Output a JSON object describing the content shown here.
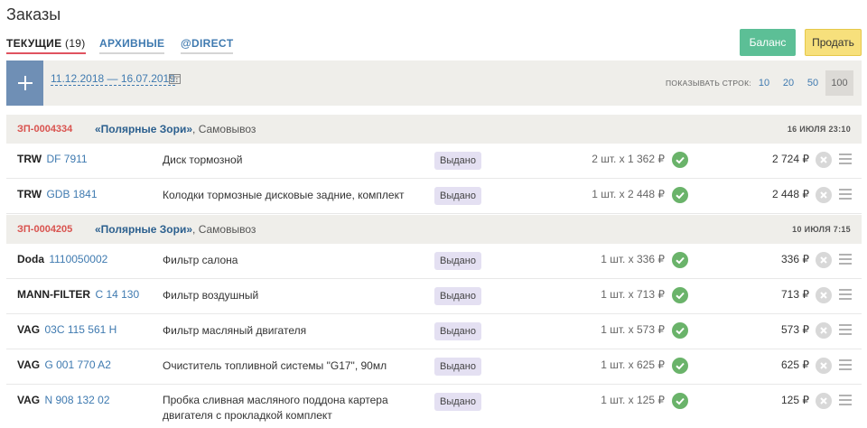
{
  "page": {
    "title": "Заказы"
  },
  "tabs": [
    {
      "label": "ТЕКУЩИЕ",
      "count": "(19)",
      "active": true
    },
    {
      "label": "АРХИВНЫЕ",
      "active": false
    },
    {
      "label": "@DIRECT",
      "active": false
    }
  ],
  "header_buttons": {
    "balance": "Баланс",
    "sell": "Продать"
  },
  "filter": {
    "date_range": "11.12.2018 — 16.07.2019",
    "rows_label": "ПОКАЗЫВАТЬ СТРОК:",
    "rows_options": [
      "10",
      "20",
      "50",
      "100"
    ],
    "rows_selected": "100"
  },
  "colors": {
    "accent": "#3f7ab0",
    "order_number": "#d9534f",
    "balance_button": "#5cbf96",
    "sell_button": "#f7e07c",
    "status_badge": "#e4e0f2",
    "check": "#6ab36a"
  },
  "icons": {
    "add": "plus-icon",
    "calendar": "calendar-icon",
    "ok": "check-circle-icon",
    "delete": "close-circle-icon",
    "menu": "hamburger-icon"
  },
  "orders": [
    {
      "number": "ЗП-0004334",
      "shop": "«Полярные Зори»",
      "delivery": ", Самовывоз",
      "date": "16 ИЮЛЯ 23:10",
      "items": [
        {
          "brand": "TRW",
          "article": "DF 7911",
          "description": "Диск тормозной",
          "status": "Выдано",
          "qty": "2 шт. х 1 362 ₽",
          "total": "2 724 ₽"
        },
        {
          "brand": "TRW",
          "article": "GDB 1841",
          "description": "Колодки тормозные дисковые задние, комплект",
          "status": "Выдано",
          "qty": "1 шт. х 2 448 ₽",
          "total": "2 448 ₽"
        }
      ]
    },
    {
      "number": "ЗП-0004205",
      "shop": "«Полярные Зори»",
      "delivery": ", Самовывоз",
      "date": "10 ИЮЛЯ 7:15",
      "items": [
        {
          "brand": "Doda",
          "article": "1110050002",
          "description": "Фильтр салона",
          "status": "Выдано",
          "qty": "1 шт. х 336 ₽",
          "total": "336 ₽"
        },
        {
          "brand": "MANN-FILTER",
          "article": "C 14 130",
          "description": "Фильтр воздушный",
          "status": "Выдано",
          "qty": "1 шт. х 713 ₽",
          "total": "713 ₽"
        },
        {
          "brand": "VAG",
          "article": "03C 115 561 H",
          "description": "Фильтр масляный двигателя",
          "status": "Выдано",
          "qty": "1 шт. х 573 ₽",
          "total": "573 ₽"
        },
        {
          "brand": "VAG",
          "article": "G 001 770 A2",
          "description": "Очиститель топливной системы \"G17\", 90мл",
          "status": "Выдано",
          "qty": "1 шт. х 625 ₽",
          "total": "625 ₽"
        },
        {
          "brand": "VAG",
          "article": "N 908 132 02",
          "description": "Пробка сливная масляного поддона картера двигателя с прокладкой комплект",
          "status": "Выдано",
          "qty": "1 шт. х 125 ₽",
          "total": "125 ₽"
        }
      ]
    }
  ]
}
